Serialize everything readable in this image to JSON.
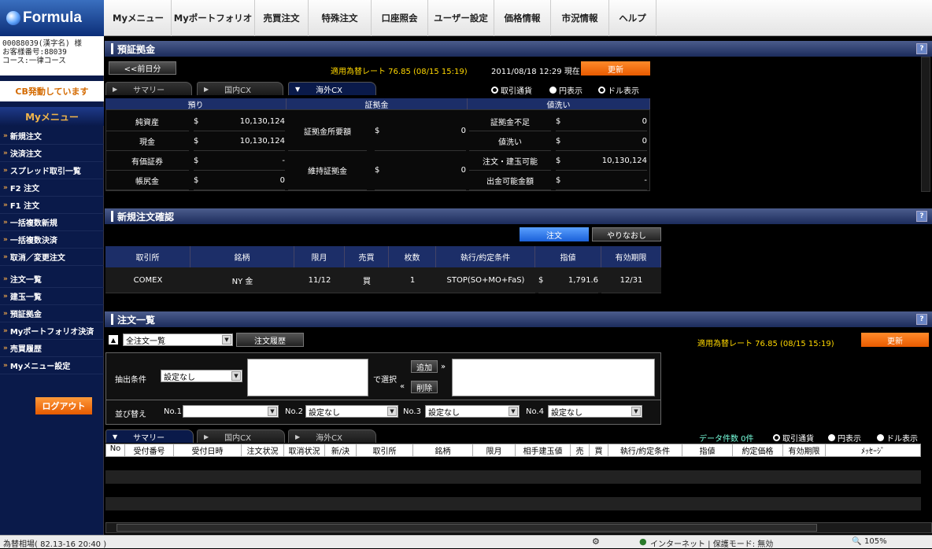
{
  "logo": "Formula",
  "nav": [
    "Myメニュー",
    "Myポートフォリオ",
    "売買注文",
    "特殊注文",
    "口座照会",
    "ユーザー設定",
    "価格情報",
    "市況情報",
    "ヘルプ"
  ],
  "account": {
    "line1": "00088039(漢字名) 様",
    "line2": "お客様番号:88039",
    "line3": "コース:一律コース"
  },
  "sidebar": {
    "cb": "CB発動しています",
    "menu_title": "Myメニュー",
    "items": [
      "新規注文",
      "決済注文",
      "スプレッド取引一覧",
      "F2 注文",
      "F1 注文",
      "一括複数新規",
      "一括複数決済",
      "取消／変更注文",
      "注文一覧",
      "建玉一覧",
      "預証拠金",
      "Myポートフォリオ決済",
      "売買履歴",
      "Myメニュー設定"
    ],
    "logout": "ログアウト"
  },
  "deposit": {
    "title": "預証拠金",
    "prev": "<<前日分",
    "rate": "適用為替レート  76.85 (08/15 15:19)",
    "asof": "2011/08/18 12:29 現在",
    "update": "更新",
    "tabs": [
      "サマリー",
      "国内CX",
      "海外CX"
    ],
    "radios": [
      "取引通貨",
      "円表示",
      "ドル表示"
    ],
    "groups": [
      "預り",
      "証拠金",
      "値洗い"
    ],
    "rows": [
      {
        "l": "純資産",
        "c": "$",
        "v": "10,130,124"
      },
      {
        "l": "現金",
        "c": "$",
        "v": "10,130,124"
      },
      {
        "l": "有価証券",
        "c": "$",
        "v": "-"
      },
      {
        "l": "帳尻金",
        "c": "$",
        "v": "0"
      }
    ],
    "mid": [
      {
        "l": "証拠金所要額",
        "c": "$",
        "v": "0"
      },
      {
        "l": "維持証拠金",
        "c": "$",
        "v": "0"
      }
    ],
    "right": [
      {
        "l": "証拠金不足",
        "c": "$",
        "v": "0"
      },
      {
        "l": "値洗い",
        "c": "$",
        "v": "0"
      },
      {
        "l": "注文・建玉可能",
        "c": "$",
        "v": "10,130,124"
      },
      {
        "l": "出金可能金額",
        "c": "$",
        "v": "-"
      }
    ]
  },
  "confirm": {
    "title": "新規注文確認",
    "order_btn": "注文",
    "redo_btn": "やりなおし",
    "headers": [
      "取引所",
      "銘柄",
      "限月",
      "売買",
      "枚数",
      "執行/約定条件",
      "指値",
      "有効期限"
    ],
    "row": {
      "exchange": "COMEX",
      "symbol": "NY 金",
      "month": "11/12",
      "side": "買",
      "qty": "1",
      "cond": "STOP(SO+MO+FaS)",
      "cur": "$",
      "price": "1,791.6",
      "expiry": "12/31"
    }
  },
  "orders": {
    "title": "注文一覧",
    "list_select": "全注文一覧",
    "history_btn": "注文履歴",
    "rate": "適用為替レート  76.85 (08/15 15:19)",
    "update": "更新",
    "filter_label": "抽出条件",
    "filter_select": "設定なし",
    "select_text": "で選択",
    "add_btn": "追加",
    "del_btn": "削除",
    "sort_label": "並び替え",
    "sorts": [
      {
        "n": "No.1",
        "v": ""
      },
      {
        "n": "No.2",
        "v": "設定なし"
      },
      {
        "n": "No.3",
        "v": "設定なし"
      },
      {
        "n": "No.4",
        "v": "設定なし"
      }
    ],
    "tabs": [
      "サマリー",
      "国内CX",
      "海外CX"
    ],
    "count": "データ件数  0件",
    "radios": [
      "取引通貨",
      "円表示",
      "ドル表示"
    ],
    "headers": [
      "No",
      "受付番号",
      "受付日時",
      "注文状況",
      "取消状況",
      "新/決",
      "取引所",
      "銘柄",
      "限月",
      "相手建玉値",
      "売",
      "買",
      "執行/約定条件",
      "指値",
      "約定価格",
      "有効期限",
      "ﾒｯｾｰｼﾞ"
    ]
  },
  "status": {
    "left": "為替相場( 82.13-16 20:40 )",
    "zone": "インターネット | 保護モード: 無効",
    "zoom": "105%"
  }
}
